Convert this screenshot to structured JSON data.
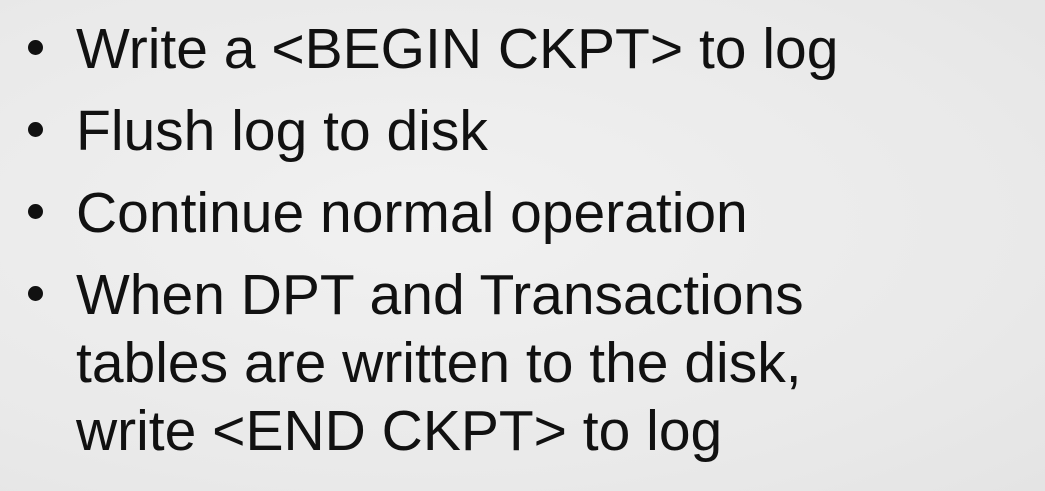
{
  "slide": {
    "bullets": [
      {
        "lines": [
          "Write a <BEGIN CKPT> to log"
        ]
      },
      {
        "lines": [
          "Flush log to disk"
        ]
      },
      {
        "lines": [
          "Continue normal operation"
        ]
      },
      {
        "lines": [
          "When DPT and Transactions",
          "tables are written to the disk,",
          "write <END CKPT> to log"
        ]
      }
    ]
  }
}
